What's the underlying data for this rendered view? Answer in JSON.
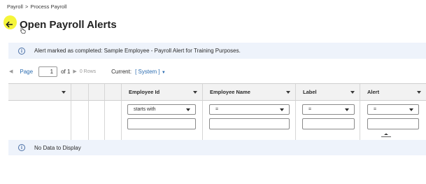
{
  "breadcrumb": {
    "items": [
      "Payroll",
      "Process Payroll"
    ],
    "separator": ">"
  },
  "header": {
    "title": "Open Payroll Alerts"
  },
  "alert": {
    "message": "Alert marked as completed: Sample Employee - Payroll Alert for Training Purposes."
  },
  "pager": {
    "page_label": "Page",
    "page_value": "1",
    "of_label": "of 1",
    "rows_label": "0 Rows",
    "current_label": "Current:",
    "view_label": "[ System ]"
  },
  "grid": {
    "columns": [
      {
        "label": "Employee Id",
        "filter_op": "starts with"
      },
      {
        "label": "Employee Name",
        "filter_op": "="
      },
      {
        "label": "Label",
        "filter_op": "="
      },
      {
        "label": "Alert",
        "filter_op": "="
      }
    ],
    "empty_message": "No Data to Display"
  },
  "colors": {
    "accent": "#2b6cb0",
    "info_bg": "#eef3fb",
    "highlight": "#f5f53a"
  },
  "icons": [
    "back-arrow-icon",
    "cursor-icon",
    "info-icon",
    "chevron-left-icon",
    "chevron-right-icon",
    "dropdown-caret-icon"
  ]
}
